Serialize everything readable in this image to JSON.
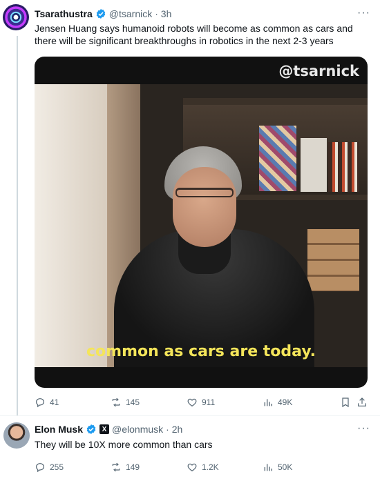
{
  "tweet1": {
    "name": "Tsarathustra",
    "handle": "@tsarnick",
    "time": "· 3h",
    "text": "Jensen Huang says humanoid robots will become as common as cars and there will be significant breakthroughs in robotics in the next 2-3 years",
    "video": {
      "watermark": "@tsarnick",
      "caption": "common as cars are today."
    },
    "stats": {
      "replies": "41",
      "reposts": "145",
      "likes": "911",
      "views": "49K"
    }
  },
  "tweet2": {
    "name": "Elon Musk",
    "handle": "@elonmusk",
    "time": "· 2h",
    "text": "They will be 10X more common than cars",
    "affiliate_badge": "X",
    "stats": {
      "replies": "255",
      "reposts": "149",
      "likes": "1.2K",
      "views": "50K"
    }
  },
  "more_glyph": "···",
  "colors": {
    "verified": "#1d9bf0",
    "muted": "#536471",
    "caption": "#f4e55a"
  }
}
